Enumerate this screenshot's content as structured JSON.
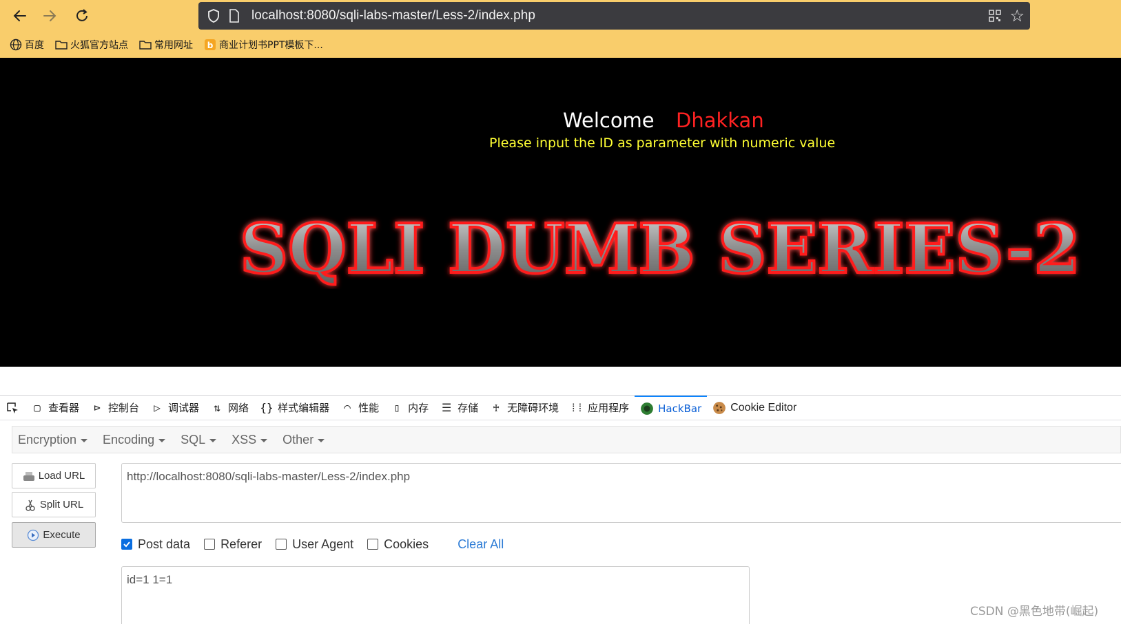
{
  "browser": {
    "url": "localhost:8080/sqli-labs-master/Less-2/index.php",
    "bookmarks": [
      "百度",
      "火狐官方站点",
      "常用网址",
      "商业计划书PPT模板下..."
    ]
  },
  "page": {
    "welcome": "Welcome",
    "name": "Dhakkan",
    "instruction": "Please input the ID as parameter with numeric value",
    "banner": "SQLI DUMB SERIES-2"
  },
  "devtools": {
    "tabs": [
      "查看器",
      "控制台",
      "调试器",
      "网络",
      "样式编辑器",
      "性能",
      "内存",
      "存储",
      "无障碍环境",
      "应用程序",
      "HackBar",
      "Cookie Editor"
    ],
    "active_tab": "HackBar"
  },
  "hackbar": {
    "menu": [
      "Encryption",
      "Encoding",
      "SQL",
      "XSS",
      "Other"
    ],
    "buttons": {
      "load": "Load URL",
      "split": "Split URL",
      "execute": "Execute"
    },
    "url_value": "http://localhost:8080/sqli-labs-master/Less-2/index.php",
    "options": {
      "post_data": "Post data",
      "referer": "Referer",
      "user_agent": "User Agent",
      "cookies": "Cookies",
      "clear_all": "Clear All"
    },
    "post_value": "id=1 1=1"
  },
  "watermark": "CSDN @黑色地带(崛起)"
}
